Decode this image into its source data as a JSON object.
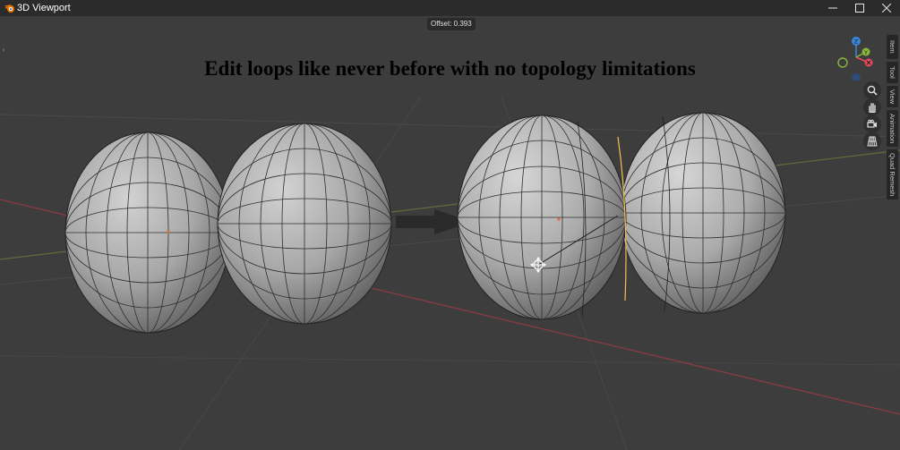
{
  "window": {
    "title": "3D Viewport",
    "colors": {
      "titlebar": "#2b2b2b",
      "viewport": "#3d3d3d",
      "x_axis": "#e84a5f",
      "y_axis": "#8ab73a",
      "z_axis": "#3a86d9",
      "selected_edge": "#f2c14e"
    }
  },
  "header": {
    "offset_label": "Offset: 0.393"
  },
  "overlay": {
    "headline": "Edit loops like never before with no topology limitations"
  },
  "gizmo": {
    "z_label": "Z",
    "y_label": "Y"
  },
  "nav_buttons": [
    {
      "name": "zoom-icon"
    },
    {
      "name": "pan-hand-icon"
    },
    {
      "name": "camera-icon"
    },
    {
      "name": "grid-icon"
    }
  ],
  "sidebar_tabs": [
    {
      "label": "Item"
    },
    {
      "label": "Tool"
    },
    {
      "label": "View"
    },
    {
      "label": "Animation"
    },
    {
      "label": "Quad Remesh"
    }
  ]
}
